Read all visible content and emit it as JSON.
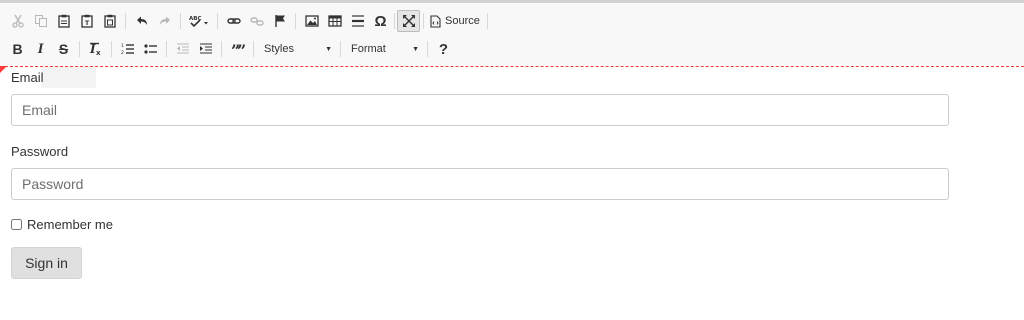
{
  "toolbar": {
    "source_label": "Source",
    "styles_label": "Styles",
    "format_label": "Format",
    "help_label": "?",
    "row1_icons": [
      "cut-icon",
      "copy-icon",
      "paste-icon",
      "paste-text-icon",
      "paste-from-word-icon",
      "undo-icon",
      "redo-icon",
      "spellcheck-icon",
      "link-icon",
      "unlink-icon",
      "anchor-icon",
      "image-icon",
      "table-icon",
      "horizontal-line-icon",
      "special-char-icon",
      "maximize-icon",
      "source-icon"
    ],
    "row2_icons": [
      "bold-icon",
      "italic-icon",
      "strike-icon",
      "remove-format-icon",
      "numbered-list-icon",
      "bulleted-list-icon",
      "outdent-icon",
      "indent-icon",
      "blockquote-icon"
    ]
  },
  "form": {
    "email_label": "Email",
    "email_placeholder": "Email",
    "password_label": "Password",
    "password_placeholder": "Password",
    "remember_label": "Remember me",
    "signin_label": "Sign in"
  },
  "colors": {
    "toolbar_bg": "#f8f8f8",
    "guide_line": "#ff3b3b",
    "button_bg": "#e0e0e0"
  }
}
